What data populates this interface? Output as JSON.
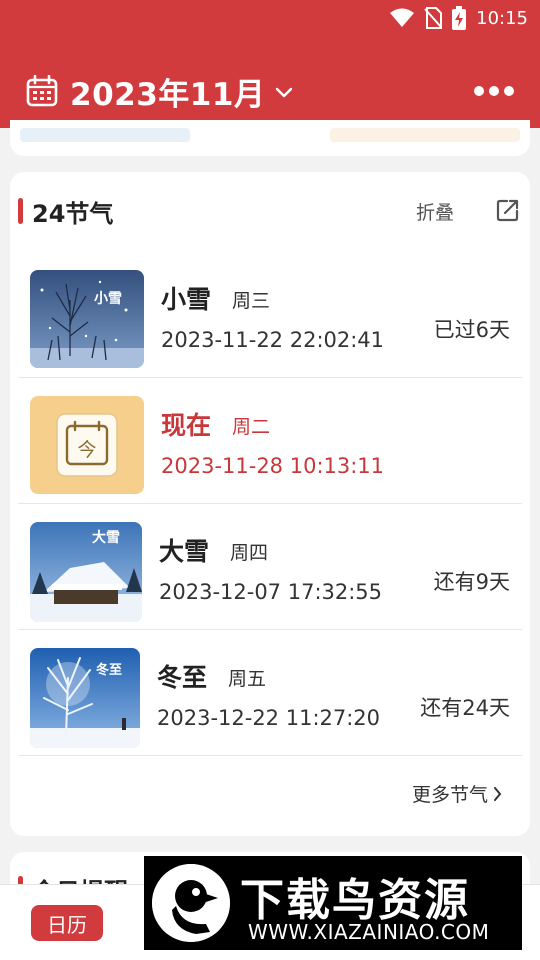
{
  "status_bar": {
    "time": "10:15"
  },
  "header": {
    "title": "2023年11月"
  },
  "solar_terms": {
    "section_title": "24节气",
    "fold_label": "折叠",
    "items": [
      {
        "name": "小雪",
        "weekday": "周三",
        "datetime": "2023-11-22 22:02:41",
        "relative": "已过6天",
        "thumb_label": "小雪"
      },
      {
        "name": "现在",
        "weekday": "周二",
        "datetime": "2023-11-28 10:13:11",
        "relative": "",
        "thumb_label": "今"
      },
      {
        "name": "大雪",
        "weekday": "周四",
        "datetime": "2023-12-07 17:32:55",
        "relative": "还有9天",
        "thumb_label": "大雪"
      },
      {
        "name": "冬至",
        "weekday": "周五",
        "datetime": "2023-12-22 11:27:20",
        "relative": "还有24天",
        "thumb_label": "冬至"
      }
    ],
    "more_label": "更多节气"
  },
  "next_section": {
    "title": "今日提醒"
  },
  "bottom_nav": {
    "calendar_tab": "日历"
  },
  "watermark": {
    "brand": "下载鸟资源",
    "url": "WWW.XIAZAINIAO.COM"
  },
  "colors": {
    "primary": "#d23b3e",
    "now_highlight": "#c8383b",
    "today_tile": "#f6cf8c"
  }
}
